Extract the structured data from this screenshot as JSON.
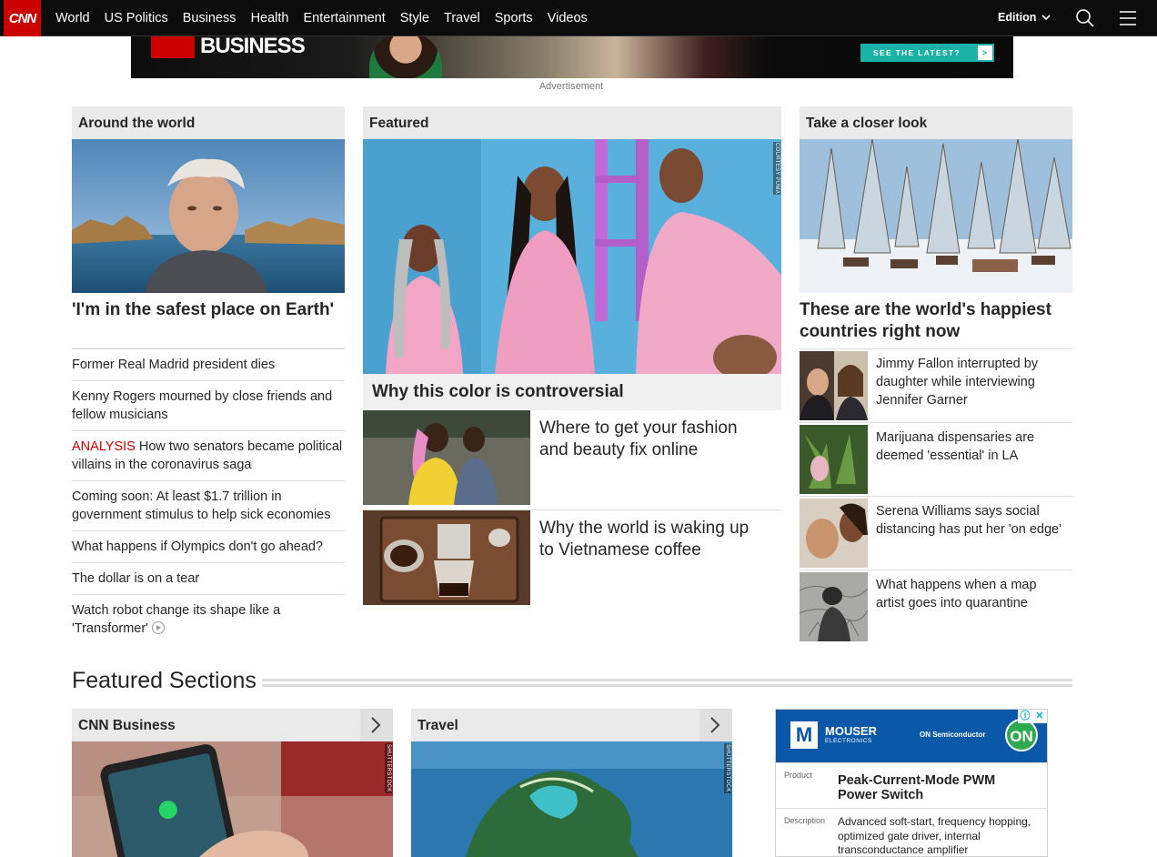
{
  "nav": {
    "logo": "CNN",
    "links": [
      "World",
      "US Politics",
      "Business",
      "Health",
      "Entertainment",
      "Style",
      "Travel",
      "Sports",
      "Videos"
    ],
    "edition": "Edition"
  },
  "ad_banner": {
    "brand": "BUSINESS",
    "cta": "SEE THE LATEST?",
    "cta_arrow": ">",
    "label": "Advertisement"
  },
  "around": {
    "heading": "Around the world",
    "headline": "'I'm in the safest place on Earth'",
    "items": [
      {
        "text": "Former Real Madrid president dies"
      },
      {
        "text": "Kenny Rogers mourned by close friends and fellow musicians"
      },
      {
        "tag": "ANALYSIS",
        "text": " How two senators became political villains in the coronavirus saga"
      },
      {
        "text": "Coming soon: At least $1.7 trillion in government stimulus to help sick economies"
      },
      {
        "text": "What happens if Olympics don't go ahead?"
      },
      {
        "text": "The dollar is on a tear"
      },
      {
        "text": "Watch robot change its shape like a 'Transformer'"
      }
    ]
  },
  "featured": {
    "heading": "Featured",
    "credit": "COURTESY PUMA",
    "caption": "Why this color is controversial",
    "sub": [
      {
        "text": "Where to get your fashion and beauty fix online"
      },
      {
        "text": "Why the world is waking up to Vietnamese coffee"
      }
    ]
  },
  "closer": {
    "heading": "Take a closer look",
    "headline": "These are the world's happiest countries right now",
    "items": [
      {
        "text": "Jimmy Fallon interrupted by daughter while interviewing Jennifer Garner"
      },
      {
        "text": "Marijuana dispensaries are deemed 'essential' in LA"
      },
      {
        "text": "Serena Williams says social distancing has put her 'on edge'"
      },
      {
        "text": "What happens when a map artist goes into quarantine"
      }
    ]
  },
  "featured_sections": {
    "title": "Featured Sections",
    "sections": [
      {
        "label": "CNN Business",
        "credit": "SHUTTERSTOCK"
      },
      {
        "label": "Travel",
        "credit": "SHUTTERSTOCK"
      }
    ]
  },
  "mouser_ad": {
    "brand": "MOUSER",
    "brand_sub": "ELECTRONICS",
    "partner": "ON Semiconductor",
    "partner_mark": "ON",
    "product_label": "Product",
    "product": "Peak-Current-Mode PWM Power Switch",
    "desc_label": "Description",
    "desc": "Advanced soft-start, frequency hopping, optimized gate driver, internal transconductance amplifier"
  },
  "colors": {
    "brand_red": "#cc0000",
    "nav_bg": "#0c0c0c",
    "header_bg": "#eaeaea"
  }
}
